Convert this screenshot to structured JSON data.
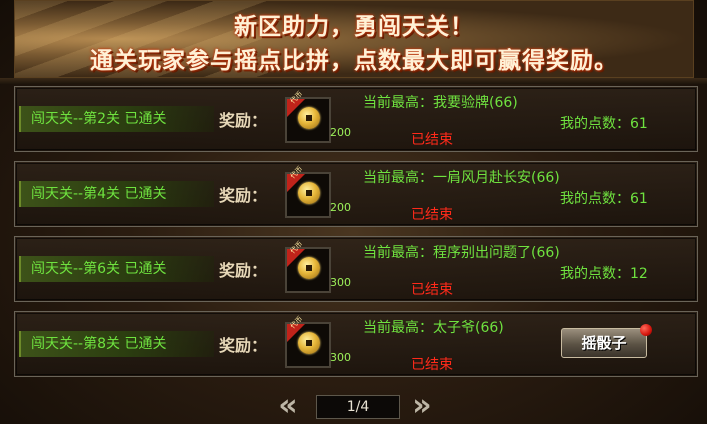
{
  "banner": {
    "line1": "新区助力，勇闯天关！",
    "line2": "通关玩家参与摇点比拼，点数最大即可赢得奖励。"
  },
  "reward_label": "奖励：",
  "coin_tag": "代币",
  "rows": [
    {
      "stage": "闯天关--第2关 已通关",
      "reward_amount": "200",
      "highest": "当前最高：我要验牌(66)",
      "status": "已结束",
      "my_points": "我的点数：61"
    },
    {
      "stage": "闯天关--第4关 已通关",
      "reward_amount": "200",
      "highest": "当前最高：一肩风月赴长安(66)",
      "status": "已结束",
      "my_points": "我的点数：61"
    },
    {
      "stage": "闯天关--第6关 已通关",
      "reward_amount": "300",
      "highest": "当前最高：程序别出问题了(66)",
      "status": "已结束",
      "my_points": "我的点数：12"
    },
    {
      "stage": "闯天关--第8关 已通关",
      "reward_amount": "300",
      "highest": "当前最高：太子爷(66)",
      "status": "已结束",
      "dice_button": "摇骰子"
    }
  ],
  "pager": {
    "prev_icon": "double-chevron-left-icon",
    "next_icon": "double-chevron-right-icon",
    "page": "1/4"
  }
}
